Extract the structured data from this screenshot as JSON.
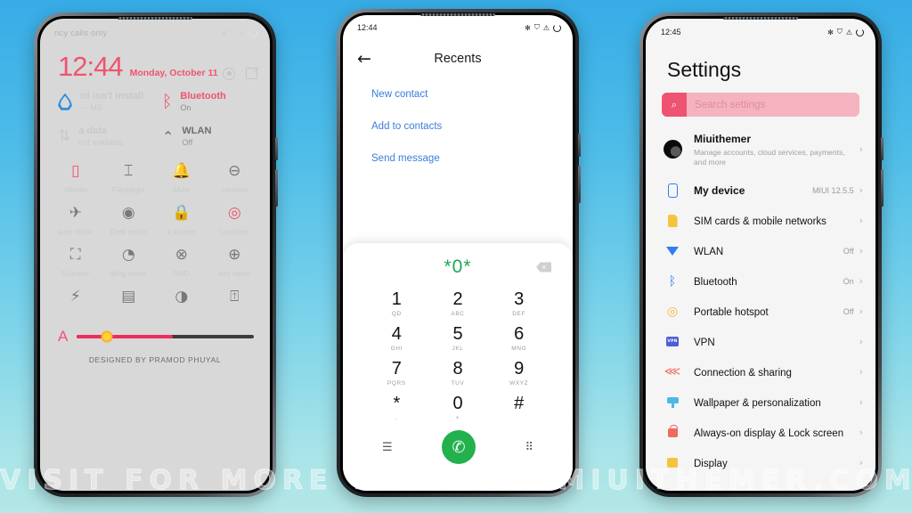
{
  "wallpaper": {
    "gradient_top": "#37ACE6",
    "gradient_bottom": "#B4E7E6"
  },
  "watermark": {
    "text": "VISIT FOR MORE THEMES - MIUITHEMER.COM"
  },
  "phone1": {
    "status_bar": {
      "carrier_text": "ncy calls only",
      "icons": [
        "bluetooth-icon",
        "alarm-icon",
        "warning-icon",
        "sync-ring-icon"
      ]
    },
    "clock": {
      "time": "12:44",
      "date": "Monday, October 11",
      "settings_icon": "settings-circle-icon",
      "edit_icon": "edit-icon"
    },
    "big_tiles": [
      {
        "title": "rd isn't install",
        "sub": "--- MB",
        "icon": "data-drop-icon",
        "state": "muted"
      },
      {
        "title": "Bluetooth",
        "sub": "On",
        "icon": "bluetooth-icon",
        "state": "on"
      },
      {
        "title": "a data",
        "sub": "not available",
        "icon": "mobile-data-icon",
        "state": "muted"
      },
      {
        "title": "WLAN",
        "sub": "Off",
        "icon": "wifi-icon",
        "state": "off"
      }
    ],
    "tiles": [
      {
        "label": "Vibrate",
        "icon": "vibrate-icon",
        "glyph": "❑",
        "active": true
      },
      {
        "label": "Flashlight",
        "icon": "flashlight-icon",
        "glyph": "🔦",
        "active": false
      },
      {
        "label": "Mute",
        "icon": "bell-icon",
        "glyph": "🔔",
        "active": false
      },
      {
        "label": "eenshot",
        "icon": "screenshot-icon",
        "glyph": "⊖",
        "active": false
      },
      {
        "label": "lane mode",
        "icon": "airplane-icon",
        "glyph": "✈",
        "active": false
      },
      {
        "label": "Dark mode",
        "icon": "dark-mode-icon",
        "glyph": "◉",
        "active": false
      },
      {
        "label": "k screen",
        "icon": "lock-screen-icon",
        "glyph": "🔒",
        "active": false
      },
      {
        "label": "Location",
        "icon": "location-icon",
        "glyph": "◎",
        "active": true
      },
      {
        "label": "Scanner",
        "icon": "scanner-icon",
        "glyph": "⛶",
        "active": false
      },
      {
        "label": "iding mode",
        "icon": "reading-mode-icon",
        "glyph": "◔",
        "active": false
      },
      {
        "label": "DND",
        "icon": "do-not-disturb-icon",
        "glyph": "⊗",
        "active": false
      },
      {
        "label": "tery saver",
        "icon": "battery-saver-icon",
        "glyph": "⊕",
        "active": false
      },
      {
        "label": "",
        "icon": "power-saver-icon",
        "glyph": "⚡",
        "active": false
      },
      {
        "label": "",
        "icon": "cast-icon",
        "glyph": "▭",
        "active": false
      },
      {
        "label": "",
        "icon": "contrast-icon",
        "glyph": "◐",
        "active": false
      },
      {
        "label": "",
        "icon": "auto-rotate-icon",
        "glyph": "⤢",
        "active": false
      }
    ],
    "brightness": {
      "auto_label": "A",
      "fill_percent": 54,
      "knob_percent": 17
    },
    "credit": "DESIGNED BY PRAMOD PHUYAL"
  },
  "phone2": {
    "status_bar": {
      "time": "12:44",
      "icons": [
        "bluetooth-icon",
        "alarm-icon",
        "warning-icon",
        "sync-ring-icon"
      ]
    },
    "app_bar": {
      "back_icon": "back-arrow-icon",
      "title": "Recents"
    },
    "links": [
      {
        "label": "New contact"
      },
      {
        "label": "Add to contacts"
      },
      {
        "label": "Send message"
      }
    ],
    "dialpad": {
      "entry": "*0*",
      "delete_icon": "backspace-icon",
      "keys": [
        {
          "digit": "1",
          "letters": "QD"
        },
        {
          "digit": "2",
          "letters": "ABC"
        },
        {
          "digit": "3",
          "letters": "DEF"
        },
        {
          "digit": "4",
          "letters": "GHI"
        },
        {
          "digit": "5",
          "letters": "JKL"
        },
        {
          "digit": "6",
          "letters": "MNO"
        },
        {
          "digit": "7",
          "letters": "PQRS"
        },
        {
          "digit": "8",
          "letters": "TUV"
        },
        {
          "digit": "9",
          "letters": "WXYZ"
        },
        {
          "digit": "*",
          "letters": ","
        },
        {
          "digit": "0",
          "letters": "+"
        },
        {
          "digit": "#",
          "letters": ""
        }
      ],
      "menu_icon": "menu-lines-icon",
      "call_icon": "call-handset-icon",
      "keypad_icon": "keypad-grid-icon",
      "call_button_color": "#22b14c",
      "entry_color": "#1fa855"
    }
  },
  "phone3": {
    "status_bar": {
      "time": "12:45",
      "icons": [
        "bluetooth-icon",
        "alarm-icon",
        "warning-icon",
        "sync-ring-icon"
      ]
    },
    "title": "Settings",
    "search": {
      "placeholder": "Search settings",
      "icon": "search-icon",
      "field_color": "#f4b3bf",
      "icon_color": "#ef5372"
    },
    "items": [
      {
        "label": "Miuithemer",
        "sub": "Manage accounts, cloud services, payments, and more",
        "value": "",
        "icon": "account-avatar"
      },
      {
        "label": "My device",
        "sub": "",
        "value": "MIUI 12.5.5",
        "icon": "phone-icon"
      },
      {
        "label": "SIM cards & mobile networks",
        "sub": "",
        "value": "",
        "icon": "sim-card-icon"
      },
      {
        "label": "WLAN",
        "sub": "",
        "value": "Off",
        "icon": "wifi-icon"
      },
      {
        "label": "Bluetooth",
        "sub": "",
        "value": "On",
        "icon": "bluetooth-icon"
      },
      {
        "label": "Portable hotspot",
        "sub": "",
        "value": "Off",
        "icon": "hotspot-icon"
      },
      {
        "label": "VPN",
        "sub": "",
        "value": "",
        "icon": "vpn-icon"
      },
      {
        "label": "Connection & sharing",
        "sub": "",
        "value": "",
        "icon": "share-icon"
      },
      {
        "label": "Wallpaper & personalization",
        "sub": "",
        "value": "",
        "icon": "wallpaper-icon"
      },
      {
        "label": "Always-on display & Lock screen",
        "sub": "",
        "value": "",
        "icon": "lock-icon"
      },
      {
        "label": "Display",
        "sub": "",
        "value": "",
        "icon": "display-icon"
      }
    ],
    "chevron": "›"
  }
}
